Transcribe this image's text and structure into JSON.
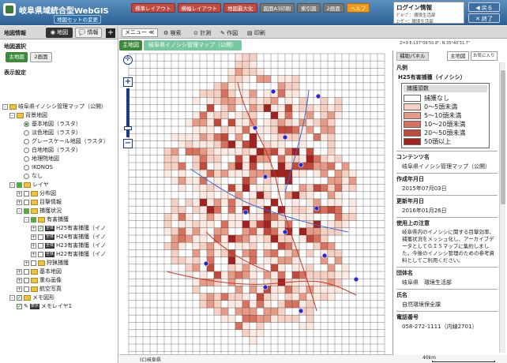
{
  "header": {
    "app_title": "岐阜県域統合型WebGIS",
    "map_set_button": "地図セットの変更",
    "toolbar": [
      "標準レイアウト",
      "横幅レイアウト",
      "地図最大化",
      "図面A3印刷",
      "索引図",
      "2画面",
      "ヘルプ"
    ],
    "login": {
      "title": "ログイン情報",
      "group_label": "ｸﾞﾙｰﾌﾟ：",
      "group_value": "環境生活部",
      "user_label": "ﾕｰｻﾞｰ：",
      "user_value": "環境生活部"
    },
    "back_label": "戻る",
    "end_label": "終了"
  },
  "left": {
    "panel_title": "地図情報",
    "tab_map": "地図",
    "tab_info": "情報",
    "map_select_title": "地図選択",
    "main_map_btn": "主地図",
    "two_screen_btn": "2画面",
    "display_settings": "表示設定",
    "tree": [
      {
        "label": "岐阜県イノシシ管理マップ（公開）"
      },
      {
        "label": "背景地図"
      },
      {
        "label": "基本地図（ラスタ）"
      },
      {
        "label": "淡色地図（ラスタ）"
      },
      {
        "label": "グレースケール地図（ラスタ）"
      },
      {
        "label": "白地地図（ラスタ）"
      },
      {
        "label": "地理院地図"
      },
      {
        "label": "IKONOS"
      },
      {
        "label": "なし"
      },
      {
        "label": "レイヤ"
      },
      {
        "label": "分布図"
      },
      {
        "label": "目撃情報"
      },
      {
        "label": "捕獲状況"
      },
      {
        "label": "有害捕獲"
      },
      {
        "label": "H25有害捕獲（イノ"
      },
      {
        "label": "H24有害捕獲（イノ"
      },
      {
        "label": "H23有害捕獲（イノ"
      },
      {
        "label": "H22有害捕獲（イノ"
      },
      {
        "label": "狩猟捕獲"
      },
      {
        "label": "基本地図"
      },
      {
        "label": "重ね画像"
      },
      {
        "label": "航空写真"
      },
      {
        "label": "メモ図形"
      },
      {
        "label": "メモレイヤ1"
      }
    ],
    "layer_tag": "全体",
    "memo_tag": "表示"
  },
  "map_toolbar": {
    "menu": "メニュー",
    "search": "検索",
    "measure": "計測",
    "draw": "作図",
    "print": "印刷"
  },
  "breadcrumb": {
    "main": "主地図",
    "map_name": "岐阜県イノシシ管理マップ（公開）"
  },
  "coords": "Z=9 E:137°06'50.8\", N:35°40'31.7\"",
  "statusbar": {
    "copyright": "(C)岐阜県",
    "scale": "40km"
  },
  "right": {
    "panel_title": "補助パネル",
    "main_btn": "主地図",
    "fav_btn": "お気に入り",
    "legend_head": "凡例",
    "legend_layer": "H25有害捕獲（イノシシ）",
    "legend_subtitle": "捕獲頭数",
    "legend": [
      {
        "label": "捕獲なし",
        "color": "#ffffff"
      },
      {
        "label": "0～5頭未満",
        "color": "#f6d0c3"
      },
      {
        "label": "5～10頭未満",
        "color": "#e79a86"
      },
      {
        "label": "10～20頭未満",
        "color": "#d8725f"
      },
      {
        "label": "20～50頭未満",
        "color": "#c24a3c"
      },
      {
        "label": "50頭以上",
        "color": "#a2221f"
      }
    ],
    "contents_h": "コンテンツ名",
    "contents_v": "岐阜県イノシシ管理マップ（公開）",
    "created_h": "作成年月日",
    "created_v": "2015年07月03日",
    "updated_h": "更新年月日",
    "updated_v": "2016年01月26日",
    "notes_h": "使用上の注意",
    "notes_v": "岐阜県内のイノシシに関する目撃効率、捕獲状況をメッシュ化し、アーカイブデータとしてＧＩＳマップに集約しました。今後のイノシシ管理のための参考資料としてご利用ください。",
    "org_h": "団体名",
    "org_v": "岐阜県　環境生活部",
    "name_h": "氏名",
    "name_v": "自然環境保全課",
    "phone_h": "電話番号",
    "phone_v": "058-272-1111（内線2701）"
  }
}
